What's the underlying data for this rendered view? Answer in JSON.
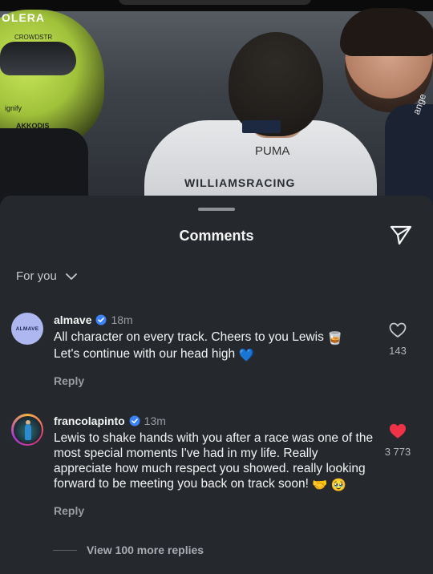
{
  "photo": {
    "helmet_text_1": "OLERA",
    "helmet_text_2": "CROWDSTR",
    "helmet_text_3": "ignify",
    "helmet_text_4": "AKKODIS",
    "jersey_brand": "PUMA",
    "jersey_text": "WILLIAMSRACING",
    "right_person_text": "ange"
  },
  "sheet": {
    "title": "Comments",
    "share_icon": "paper-plane-icon",
    "filter_label": "For you",
    "filter_icon": "chevron-down-icon"
  },
  "comments": [
    {
      "avatar_text": "ALMAVE",
      "username": "almave",
      "verified": true,
      "time": "18m",
      "text": "All character on every track. Cheers to you Lewis",
      "text2": "Let's continue with our head high",
      "emoji_1": "🥃",
      "emoji_2": "💙",
      "reply_label": "Reply",
      "liked": false,
      "like_count": "143"
    },
    {
      "username": "francolapinto",
      "verified": true,
      "time": "13m",
      "text": "Lewis to shake hands with you after a race was one of the most special moments I've had in my life. Really appreciate how much respect you showed. really looking forward to be meeting you back on track soon!",
      "emoji_1": "🤝",
      "emoji_2": "🥹",
      "reply_label": "Reply",
      "liked": true,
      "like_count": "3 773"
    }
  ],
  "more_replies": "View 100 more replies",
  "colors": {
    "sheet_bg": "#25292e",
    "verified_blue": "#3b82f6",
    "like_red": "#ef3346"
  }
}
